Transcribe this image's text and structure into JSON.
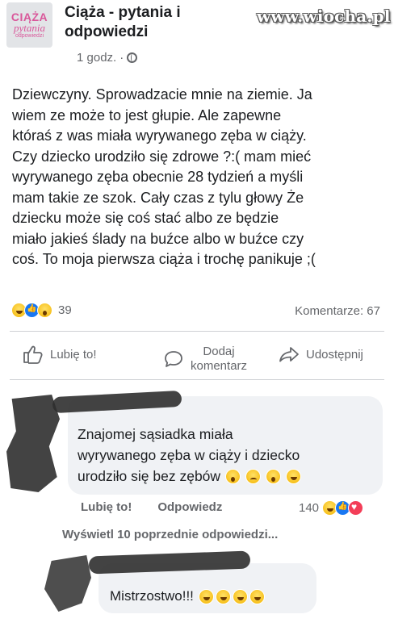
{
  "watermark": "www.wiocha.pl",
  "group": {
    "logo_line1": "CIĄŻA",
    "logo_line2": "pytania",
    "logo_line3": "odpowiedzi",
    "name": "Ciąża - pytania i odpowiedzi",
    "time": "1 godz.",
    "separator": "·",
    "privacy_icon": "globe-icon"
  },
  "post": {
    "lines": [
      "Dziewczyny. Sprowadzacie mnie na ziemie. Ja",
      "wiem ze może to jest głupie. Ale zapewne",
      "któraś z was miała wyrywanego zęba w ciąży.",
      "Czy dziecko urodziło się zdrowe ?:( mam mieć",
      "wyrywanego zęba obecnie 28 tydzień a myśli",
      "mam takie ze szok. Cały czas z tylu głowy Że",
      "dziecku może się coś stać  albo ze będzie",
      "miało jakieś ślady na buźce albo w buźce czy",
      "coś. To moja pierwsza ciąża i trochę panikuje ;("
    ],
    "reactions_count": "39",
    "comments_count": "Komentarze: 67"
  },
  "actions": {
    "like": "Lubię to!",
    "comment_line1": "Dodaj",
    "comment_line2": "komentarz",
    "share": "Udostępnij"
  },
  "comment1": {
    "lines": [
      "Znajomej sąsiadka miała",
      "wyrywanego zęba w ciąży i dziecko",
      "urodziło się bez zębów"
    ],
    "like_label": "Lubię to!",
    "reply_label": "Odpowiedz",
    "reactions_count": "140"
  },
  "previous_replies": "Wyświetl 10 poprzednie odpowiedzi...",
  "comment2": {
    "text": "Mistrzostwo!!!"
  },
  "colors": {
    "meta_gray": "#65676b",
    "bubble": "#f0f2f5",
    "like_blue": "#1877f2",
    "love_red": "#f33e58",
    "logo_pink": "#d9579a"
  }
}
